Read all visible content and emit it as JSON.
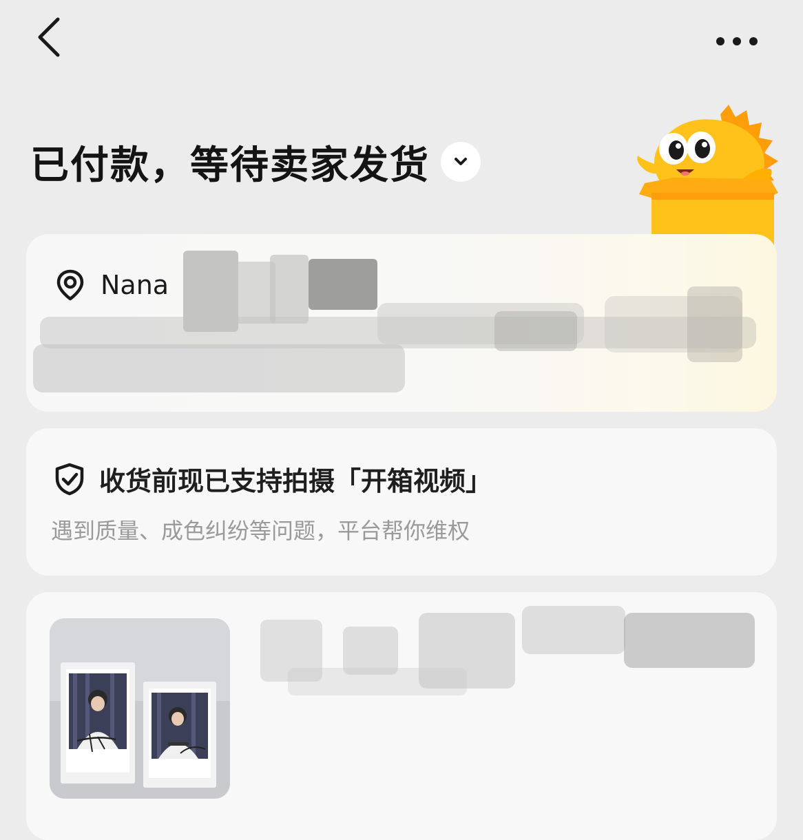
{
  "order": {
    "status_title": "已付款，等待卖家发货"
  },
  "address": {
    "name": "Nana"
  },
  "unboxing": {
    "title": "收货前现已支持拍摄「开箱视频」",
    "subtitle": "遇到质量、成色纠纷等问题，平台帮你维权"
  },
  "icons": {
    "back": "chevron-left-icon",
    "more": "more-horizontal-icon",
    "toggle": "chevron-down-icon",
    "location": "location-pin-icon",
    "protection": "shield-check-icon"
  },
  "colors": {
    "mascot_yellow": "#ffc21a",
    "mascot_orange": "#ff9d0a",
    "background": "#ececec",
    "card": "#f8f8f8",
    "subtitle_gray": "#9a9a9a"
  }
}
